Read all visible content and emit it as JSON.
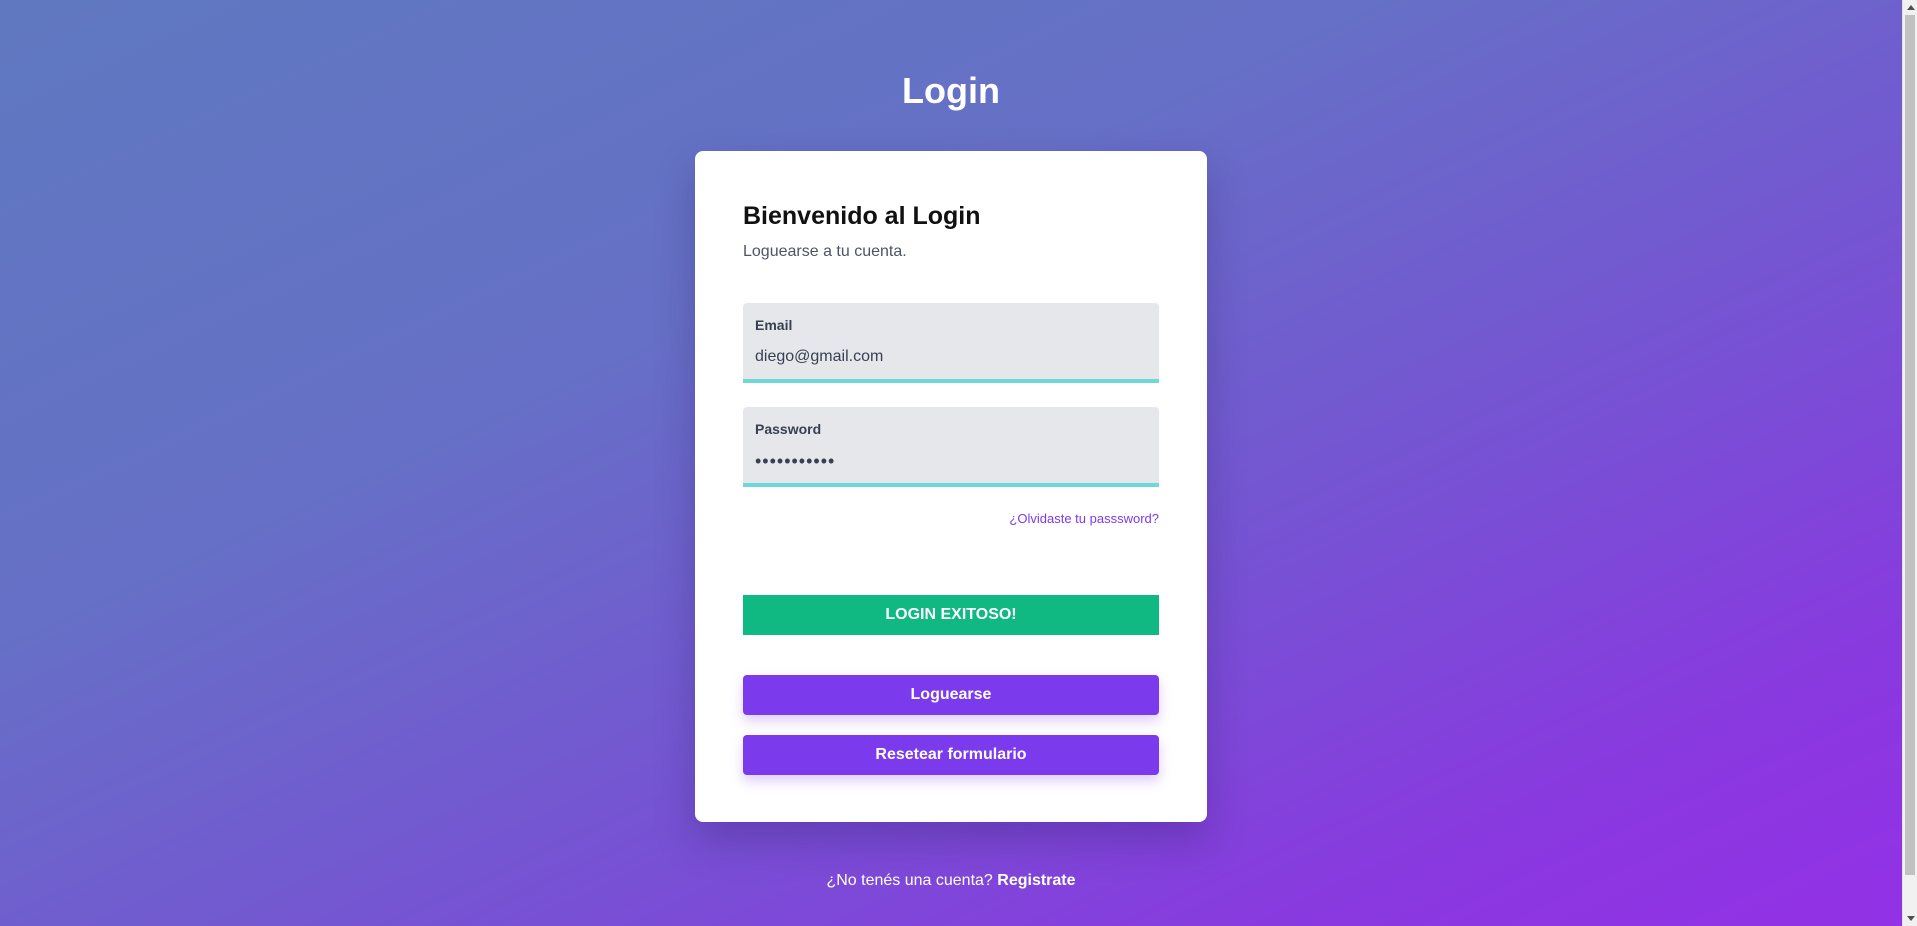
{
  "page": {
    "title": "Login"
  },
  "card": {
    "heading": "Bienvenido al Login",
    "subtitle": "Loguearse a tu cuenta."
  },
  "form": {
    "email": {
      "label": "Email",
      "value": "diego@gmail.com"
    },
    "password": {
      "label": "Password",
      "value": "•••••••••••"
    },
    "forgot_link": "¿Olvidaste tu passsword?",
    "success_message": "LOGIN EXITOSO!",
    "login_button": "Loguearse",
    "reset_button": "Resetear formulario"
  },
  "footer": {
    "prompt": "¿No tenés una cuenta?",
    "register_link": "Registrate"
  },
  "colors": {
    "accent": "#7c3aed",
    "success": "#10b981",
    "field_underline": "#6ed8d8"
  },
  "icons": {
    "scroll_up": "scroll-up-arrow-icon",
    "scroll_down": "scroll-down-arrow-icon"
  }
}
